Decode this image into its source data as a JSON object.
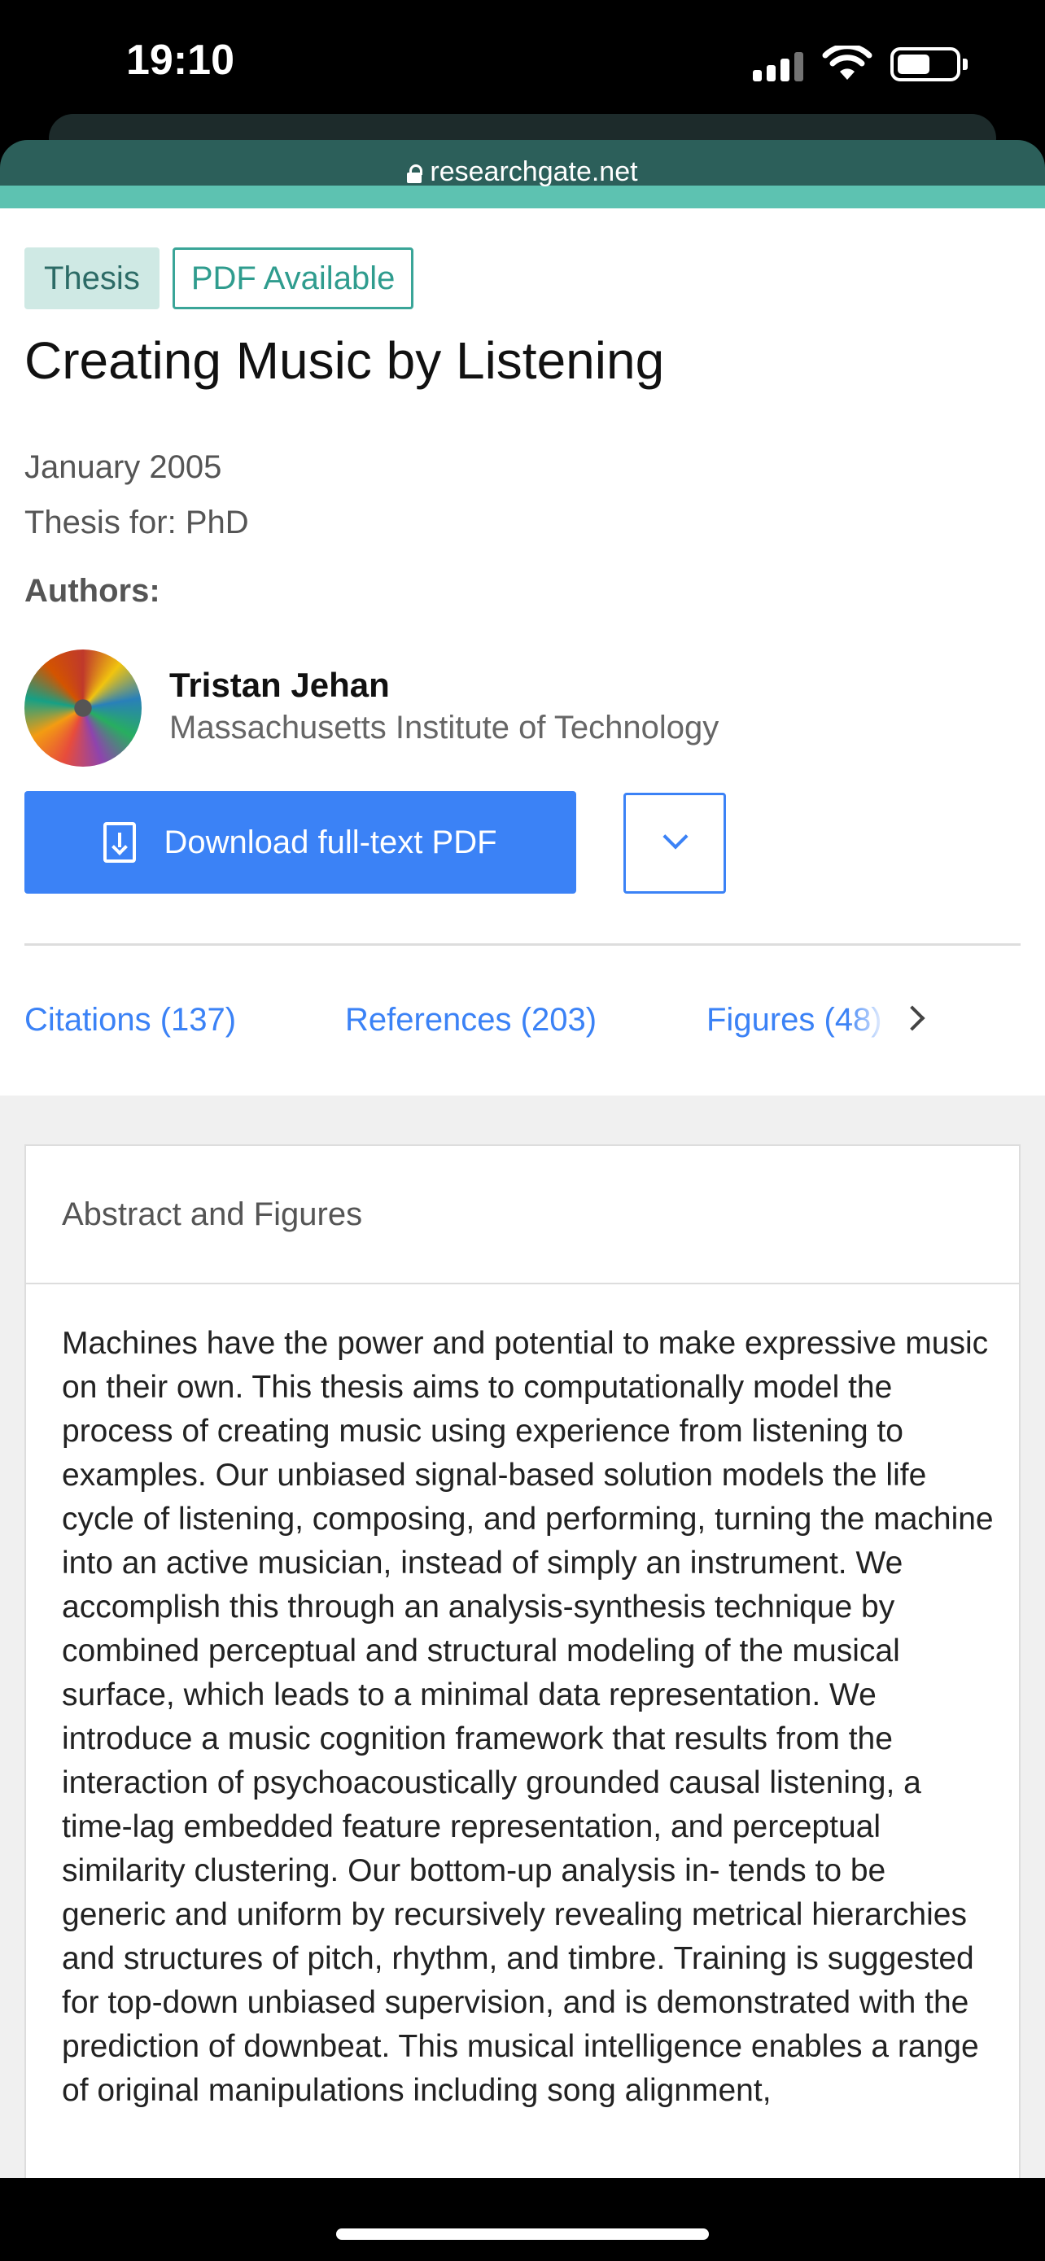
{
  "status_bar": {
    "time": "19:10"
  },
  "browser": {
    "url": "researchgate.net"
  },
  "badges": {
    "type": "Thesis",
    "availability": "PDF Available"
  },
  "publication": {
    "title": "Creating Music by Listening",
    "date": "January 2005",
    "thesis_for": "Thesis for: PhD",
    "authors_label": "Authors:"
  },
  "author": {
    "name": "Tristan Jehan",
    "institution": "Massachusetts Institute of Technology"
  },
  "actions": {
    "download_label": "Download full-text PDF"
  },
  "tabs": [
    {
      "label": "Citations (137)"
    },
    {
      "label": "References (203)"
    },
    {
      "label": "Figures (48)"
    }
  ],
  "abstract_card": {
    "title": "Abstract and Figures",
    "text": "Machines have the power and potential to make expressive music on their own. This thesis aims to computationally model the process of creating music using experience from listening to examples. Our unbiased signal-based solution models the life cycle of listening, composing, and performing, turning the machine into an active musician, instead of simply an instrument. We accomplish this through an analysis-synthesis technique by combined perceptual and structural modeling of the musical surface, which leads to a minimal data representation. We introduce a music cognition framework that results from the interaction of psychoacoustically grounded causal listening, a time-lag embedded feature representation, and perceptual similarity clustering. Our bottom-up analysis in- tends to be generic and uniform by recursively revealing metrical hierarchies and structures of pitch, rhythm, and timbre. Training is suggested for top-down unbiased supervision, and is demonstrated with the prediction of downbeat. This musical intelligence enables a range of original manipulations including song alignment,"
  },
  "colors": {
    "accent": "#3b82f6",
    "brand_teal": "#2c5f5a"
  },
  "battery_level": 0.55
}
